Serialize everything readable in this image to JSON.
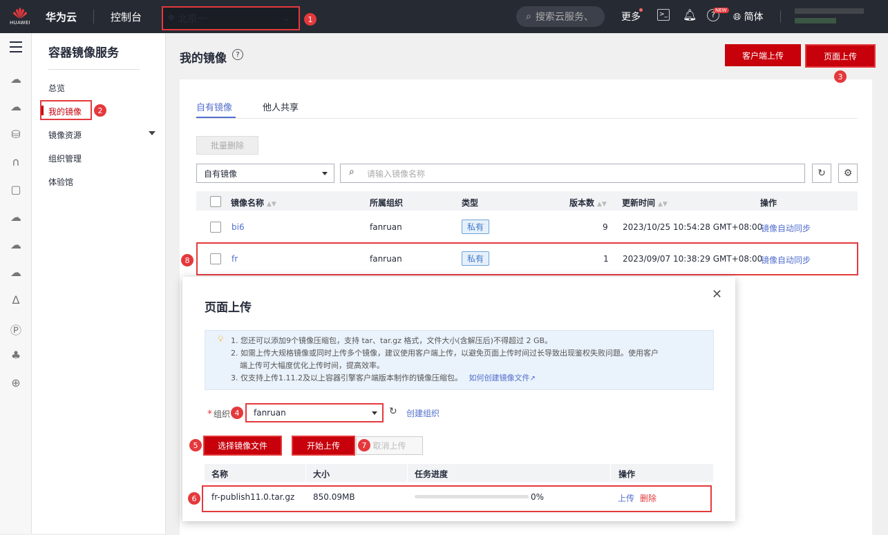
{
  "topbar": {
    "logo_text": "HUAWEI",
    "brand": "华为云",
    "console": "控制台",
    "region": "北京一",
    "search_placeholder": "搜索云服务、",
    "more": "更多",
    "new_badge": "NEW",
    "lang": "简体"
  },
  "sidenav": {
    "title": "容器镜像服务",
    "items": [
      "总览",
      "我的镜像",
      "镜像资源",
      "组织管理",
      "体验馆"
    ]
  },
  "page": {
    "title": "我的镜像",
    "client_upload": "客户端上传",
    "page_upload": "页面上传"
  },
  "tabs": [
    "自有镜像",
    "他人共享"
  ],
  "toolbar": {
    "batch_delete": "批量删除",
    "filter_value": "自有镜像",
    "search_placeholder": "请输入镜像名称"
  },
  "table": {
    "headers": [
      "镜像名称",
      "所属组织",
      "类型",
      "版本数",
      "更新时间",
      "操作"
    ],
    "rows": [
      {
        "name": "bi6",
        "org": "fanruan",
        "type": "私有",
        "versions": "9",
        "updated": "2023/10/25 10:54:28 GMT+08:00",
        "action": "镜像自动同步"
      },
      {
        "name": "fr",
        "org": "fanruan",
        "type": "私有",
        "versions": "1",
        "updated": "2023/09/07 10:38:29 GMT+08:00",
        "action": "镜像自动同步"
      }
    ]
  },
  "modal": {
    "title": "页面上传",
    "notice": [
      "1. 您还可以添加9个镜像压缩包，支持 tar、tar.gz 格式，文件大小(含解压后)不得超过 2 GB。",
      "2. 如需上传大规格镜像或同时上传多个镜像，建议使用客户端上传，以避免页面上传时间过长导致出现鉴权失败问题。使用客户",
      "端上传可大幅度优化上传时间，提高效率。",
      "3. 仅支持上传1.11.2及以上容器引擎客户端版本制作的镜像压缩包。",
      "如何创建镜像文件"
    ],
    "org_label": "组织",
    "org_value": "fanruan",
    "create_org": "创建组织",
    "select_file": "选择镜像文件",
    "start_upload": "开始上传",
    "cancel_upload": "取消上传",
    "headers": [
      "名称",
      "大小",
      "任务进度",
      "操作"
    ],
    "file": {
      "name": "fr-publish11.0.tar.gz",
      "size": "850.09MB",
      "progress": "0%",
      "progress_value": 0,
      "upload": "上传",
      "delete": "删除"
    }
  },
  "markers": [
    "1",
    "2",
    "3",
    "4",
    "5",
    "6",
    "7",
    "8"
  ],
  "colors": {
    "accent": "#c7000b",
    "link": "#526ecc",
    "marker": "#e4393c",
    "topbar": "#262a33"
  }
}
